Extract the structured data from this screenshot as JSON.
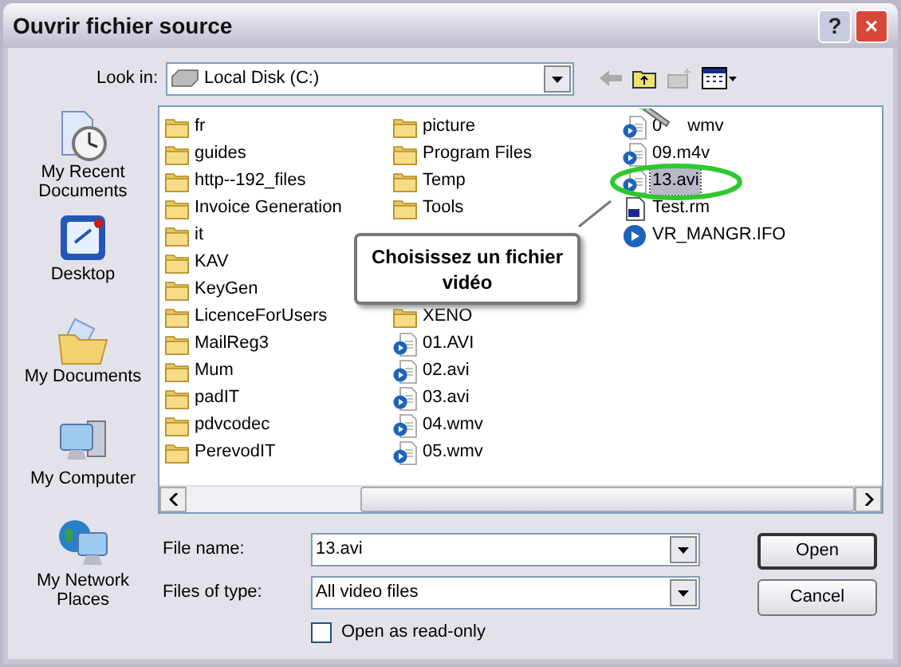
{
  "window": {
    "title": "Ouvrir fichier source",
    "buttons": [
      "?",
      "×"
    ]
  },
  "look_in": {
    "label": "Look in:",
    "value": "Local Disk (C:)"
  },
  "places": [
    {
      "kind": "recent",
      "label": "My Recent Documents"
    },
    {
      "kind": "desktop",
      "label": "Desktop"
    },
    {
      "kind": "documents",
      "label": "My Documents"
    },
    {
      "kind": "computer",
      "label": "My Computer"
    },
    {
      "kind": "network",
      "label": "My Network Places"
    }
  ],
  "files": {
    "column_1": [
      {
        "kind": "folder",
        "name": "fr",
        "selected": false
      },
      {
        "kind": "folder",
        "name": "guides",
        "selected": false
      },
      {
        "kind": "folder",
        "name": "http--192_files",
        "selected": false
      },
      {
        "kind": "folder",
        "name": "Invoice Generation",
        "selected": false
      },
      {
        "kind": "folder",
        "name": "it",
        "selected": false
      },
      {
        "kind": "folder",
        "name": "KAV",
        "selected": false
      },
      {
        "kind": "folder",
        "name": "KeyGen",
        "selected": false
      },
      {
        "kind": "folder",
        "name": "LicenceForUsers",
        "selected": false
      },
      {
        "kind": "folder",
        "name": "MailReg3",
        "selected": false
      },
      {
        "kind": "folder",
        "name": "Mum",
        "selected": false
      },
      {
        "kind": "folder",
        "name": "padIT",
        "selected": false
      },
      {
        "kind": "folder",
        "name": "pdvcodec",
        "selected": false
      },
      {
        "kind": "folder",
        "name": "PerevodIT",
        "selected": false
      }
    ],
    "column_2_top": [
      {
        "kind": "folder",
        "name": "picture",
        "selected": false
      },
      {
        "kind": "folder",
        "name": "Program Files",
        "selected": false
      },
      {
        "kind": "folder",
        "name": "Temp",
        "selected": false
      },
      {
        "kind": "folder",
        "name": "Tools",
        "selected": false
      }
    ],
    "column_2_bottom": [
      {
        "kind": "folder",
        "name": "XENO",
        "selected": false
      },
      {
        "kind": "video",
        "name": "01.AVI",
        "selected": false
      },
      {
        "kind": "video",
        "name": "02.avi",
        "selected": false
      },
      {
        "kind": "video",
        "name": "03.avi",
        "selected": false
      },
      {
        "kind": "video",
        "name": "04.wmv",
        "selected": false
      },
      {
        "kind": "video",
        "name": "05.wmv",
        "selected": false
      }
    ],
    "column_3": [
      {
        "kind": "video",
        "name": "0",
        "tail": "wmv",
        "selected": false
      },
      {
        "kind": "video",
        "name": "09.m4v",
        "selected": false
      },
      {
        "kind": "video",
        "name": "13.avi",
        "selected": true
      },
      {
        "kind": "media",
        "name": "Test.rm",
        "selected": false
      },
      {
        "kind": "disc",
        "name": "VR_MANGR.IFO",
        "selected": false
      }
    ]
  },
  "callout": "Choisissez un fichier vidéo",
  "file_name": {
    "label": "File name:",
    "value": "13.avi"
  },
  "file_type": {
    "label": "Files of type:",
    "value": "All video files"
  },
  "read_only": {
    "label": "Open as read-only",
    "checked": false
  },
  "buttons": [
    "Open",
    "Cancel"
  ]
}
